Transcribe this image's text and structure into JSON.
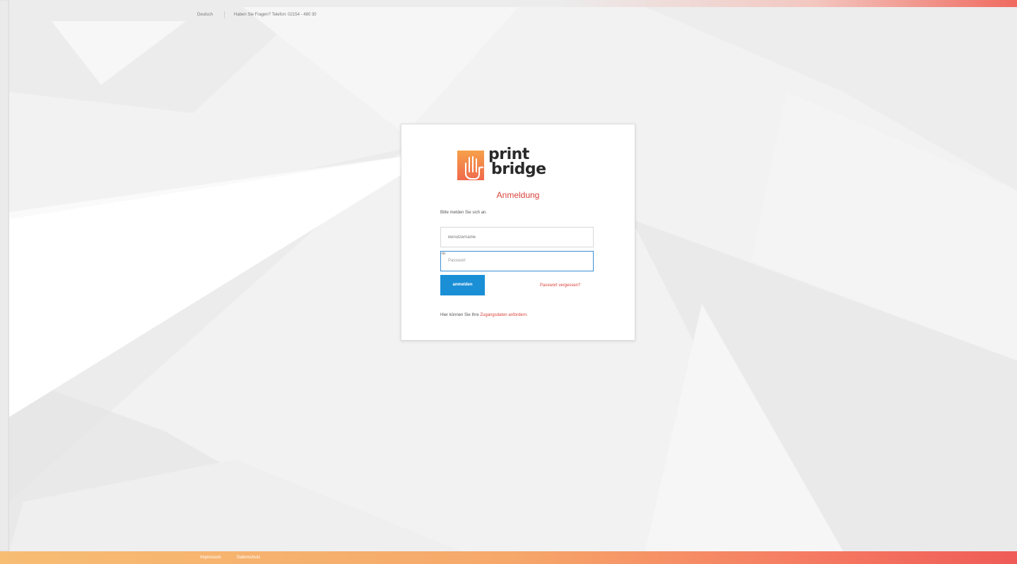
{
  "topbar": {
    "language": "Deutsch",
    "contact": "Haben Sie Fragen? Telefon: 02154 - 480 30"
  },
  "brand": {
    "line1": "print",
    "line2": "bridge",
    "logo_icon": "hand-icon",
    "colors": {
      "accent": "#d8433b",
      "button": "#1a8fd6",
      "logo_gradient_top": "#f6a04a",
      "logo_gradient_bottom": "#ef6a4c"
    }
  },
  "login": {
    "heading": "Anmeldung",
    "intro": "Bitte melden Sie sich an.",
    "username_placeholder": "Benutzername",
    "password_placeholder": "Passwort",
    "submit_label": "anmelden",
    "forgot_label": "Passwort vergessen?",
    "request_prefix": "Hier können Sie Ihre ",
    "request_link": "Zugangsdaten anfordern."
  },
  "footer": {
    "impressum": "Impressum",
    "datenschutz": "Datenschutz"
  }
}
